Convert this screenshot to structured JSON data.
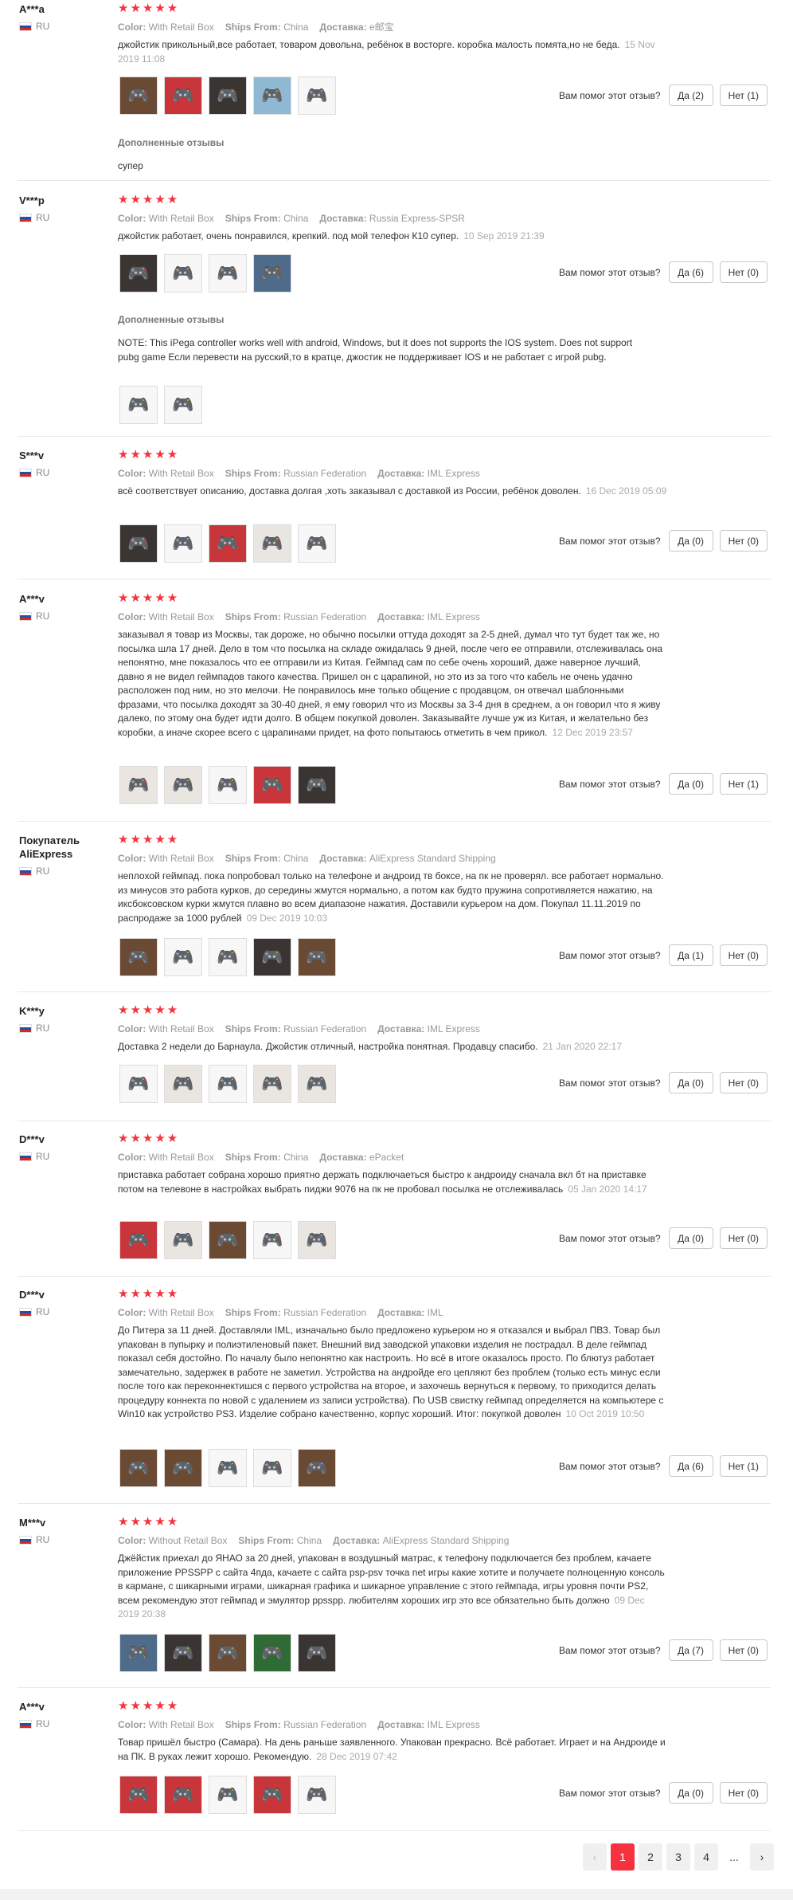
{
  "labels": {
    "color": "Color:",
    "ships_from": "Ships From:",
    "delivery": "Доставка:",
    "helpful_q": "Вам помог этот отзыв?",
    "additional": "Дополненные отзывы"
  },
  "reviews": [
    {
      "user": "A***a",
      "country": "RU",
      "stars": "★★★★★",
      "color": "With Retail Box",
      "ships_from": "China",
      "delivery": "e邮宝",
      "text": "джойстик прикольный,все работает, товаром довольна, ребёнок в восторге. коробка малость помята,но не беда.",
      "date": "15 Nov 2019 11:08",
      "yes": "Да (2)",
      "no": "Нет (1)",
      "photos": [
        {
          "icon": "gamepad-photo"
        },
        {
          "icon": "gamepad-photo"
        },
        {
          "icon": "gamepad-photo"
        },
        {
          "icon": "gamepad-photo"
        },
        {
          "icon": "gamepad-photo"
        }
      ],
      "additional": {
        "text": "супер",
        "photos": []
      }
    },
    {
      "user": "V***p",
      "country": "RU",
      "stars": "★★★★★",
      "color": "With Retail Box",
      "ships_from": "China",
      "delivery": "Russia Express-SPSR",
      "text": "джойстик работает, очень понравился, крепкий. под мой телефон К10 супер.",
      "date": "10 Sep 2019 21:39",
      "yes": "Да (6)",
      "no": "Нет (0)",
      "photos": [
        {
          "icon": "gamepad-photo"
        },
        {
          "icon": "gamepad-photo"
        },
        {
          "icon": "gamepad-photo"
        },
        {
          "icon": "gamepad-photo"
        }
      ],
      "additional": {
        "text": "NOTE: This iPega controller works well with android, Windows, but it does not supports the IOS system. Does not support pubg game Если перевести на русский,то в кратце, джостик не поддерживает IOS и не работает с игрой pubg.",
        "photos": [
          {
            "icon": "gamepad-photo"
          },
          {
            "icon": "gamepad-photo"
          }
        ]
      }
    },
    {
      "user": "S***v",
      "country": "RU",
      "stars": "★★★★★",
      "color": "With Retail Box",
      "ships_from": "Russian Federation",
      "delivery": "IML Express",
      "text": "всё соответствует описанию, доставка долгая ,хоть заказывал с доставкой из России, ребёнок доволен.",
      "date": "16 Dec 2019 05:09",
      "yes": "Да (0)",
      "no": "Нет (0)",
      "photos": [
        {
          "icon": "gamepad-photo"
        },
        {
          "icon": "gamepad-photo"
        },
        {
          "icon": "gamepad-photo"
        },
        {
          "icon": "gamepad-photo"
        },
        {
          "icon": "gamepad-photo"
        }
      ],
      "additional": null
    },
    {
      "user": "A***v",
      "country": "RU",
      "stars": "★★★★★",
      "color": "With Retail Box",
      "ships_from": "Russian Federation",
      "delivery": "IML Express",
      "text": "заказывал я товар из Москвы, так дороже, но обычно посылки оттуда доходят за 2-5 дней, думал что тут будет так же, но посылка шла 17 дней. Дело в том что посылка на складе ожидалась 9 дней, после чего ее отправили, отслеживалась она непонятно, мне показалось что ее отправили из Китая. Геймпад сам по себе очень хороший, даже наверное лучший, давно я не видел геймпадов такого качества. Пришел он с царапиной, но это из за того что кабель не очень удачно расположен под ним, но это мелочи. Не понравилось мне только общение с продавцом, он отвечал шаблонными фразами, что посылка доходят за 30-40 дней, я ему говорил что из Москвы за 3-4 дня в среднем, а он говорил что я живу далеко, по этому она будет идти долго. В общем покупкой доволен. Заказывайте лучше уж из Китая, и желательно без коробки, а иначе скорее всего с царапинами придет, на фото попытаюсь отметить в чем прикол.",
      "date": "12 Dec 2019 23:57",
      "yes": "Да (0)",
      "no": "Нет (1)",
      "photos": [
        {
          "icon": "gamepad-photo"
        },
        {
          "icon": "gamepad-photo"
        },
        {
          "icon": "gamepad-photo"
        },
        {
          "icon": "gamepad-photo"
        },
        {
          "icon": "gamepad-photo"
        }
      ],
      "additional": null
    },
    {
      "user": "Покупатель AliExpress",
      "country": "RU",
      "stars": "★★★★★",
      "color": "With Retail Box",
      "ships_from": "China",
      "delivery": "AliExpress Standard Shipping",
      "text": "неплохой геймпад. пока попробовал только на телефоне и андроид тв боксе, на пк не проверял. все работает нормально. из минусов это работа курков, до середины жмутся нормально, а потом как будто пружина сопротивляется нажатию, на иксбоксовском курки жмутся плавно во всем диапазоне нажатия. Доставили курьером на дом. Покупал 11.11.2019 по распродаже за 1000 рублей",
      "date": "09 Dec 2019 10:03",
      "yes": "Да (1)",
      "no": "Нет (0)",
      "photos": [
        {
          "icon": "gamepad-photo"
        },
        {
          "icon": "gamepad-photo"
        },
        {
          "icon": "gamepad-photo"
        },
        {
          "icon": "gamepad-photo"
        },
        {
          "icon": "gamepad-photo"
        }
      ],
      "additional": null
    },
    {
      "user": "K***y",
      "country": "RU",
      "stars": "★★★★★",
      "color": "With Retail Box",
      "ships_from": "Russian Federation",
      "delivery": "IML Express",
      "text": "Доставка 2 недели до Барнаула. Джойстик отличный, настройка понятная. Продавцу спасибо.",
      "date": "21 Jan 2020 22:17",
      "yes": "Да (0)",
      "no": "Нет (0)",
      "photos": [
        {
          "icon": "gamepad-photo"
        },
        {
          "icon": "gamepad-photo"
        },
        {
          "icon": "gamepad-photo"
        },
        {
          "icon": "gamepad-photo"
        },
        {
          "icon": "gamepad-photo"
        }
      ],
      "additional": null
    },
    {
      "user": "D***v",
      "country": "RU",
      "stars": "★★★★★",
      "color": "With Retail Box",
      "ships_from": "China",
      "delivery": "ePacket",
      "text": "приставка работает собрана хорошо приятно держать подключаеться быстро к андроиду сначала вкл бт на приставке потом на телевоне в настройках выбрать пиджи 9076 на пк не пробовал посылка не отслеживалась",
      "date": "05 Jan 2020 14:17",
      "yes": "Да (0)",
      "no": "Нет (0)",
      "photos": [
        {
          "icon": "gamepad-photo"
        },
        {
          "icon": "gamepad-photo"
        },
        {
          "icon": "gamepad-photo"
        },
        {
          "icon": "gamepad-photo"
        },
        {
          "icon": "gamepad-photo"
        }
      ],
      "additional": null
    },
    {
      "user": "D***v",
      "country": "RU",
      "stars": "★★★★★",
      "color": "With Retail Box",
      "ships_from": "Russian Federation",
      "delivery": "IML",
      "text": "До Питера за 11 дней. Доставляли IML, изначально было предложено курьером но я отказался и выбрал ПВЗ. Товар был упакован в пупырку и полиэтиленовый пакет. Внешний вид заводской упаковки изделия не пострадал. В деле геймпад показал себя достойно. По началу было непонятно как настроить. Но всё в итоге оказалось просто. По блютуз работает замечательно, задержек в работе не заметил. Устройства на андройде его цепляют без проблем (только есть минус если после того как переконнектишся с первого устройства на второе, и захочешь вернуться к первому, то приходится делать процедуру коннекта по новой с удалением из записи устройства). По USB свистку геймпад определяется на компьютере с Win10 как устройство PS3. Изделие собрано качественно, корпус хороший. Итог: покупкой доволен",
      "date": "10 Oct 2019 10:50",
      "yes": "Да (6)",
      "no": "Нет (1)",
      "photos": [
        {
          "icon": "gamepad-photo"
        },
        {
          "icon": "gamepad-photo"
        },
        {
          "icon": "gamepad-photo"
        },
        {
          "icon": "gamepad-photo"
        },
        {
          "icon": "gamepad-photo"
        }
      ],
      "additional": null
    },
    {
      "user": "M***v",
      "country": "RU",
      "stars": "★★★★★",
      "color": "Without Retail Box",
      "ships_from": "China",
      "delivery": "AliExpress Standard Shipping",
      "text": "Джёйстик приехал до ЯНАО за 20 дней, упакован в воздушный матрас, к телефону подключается без проблем, качаете приложение PPSSPP с сайта 4пда, качаете с сайта psp-psv точка net игры какие хотите и получаете полноценную консоль в кармане, с шикарными играми, шикарная графика и шикарное управление с этого геймпада, игры уровня почти PS2, всем рекомендую этот геймпад и эмулятор ppsspp. любителям хороших игр это все обязательно быть должно",
      "date": "09 Dec 2019 20:38",
      "yes": "Да (7)",
      "no": "Нет (0)",
      "photos": [
        {
          "icon": "gamepad-photo"
        },
        {
          "icon": "gamepad-photo"
        },
        {
          "icon": "gamepad-photo"
        },
        {
          "icon": "gamepad-photo"
        },
        {
          "icon": "gamepad-photo"
        }
      ],
      "additional": null
    },
    {
      "user": "A***v",
      "country": "RU",
      "stars": "★★★★★",
      "color": "With Retail Box",
      "ships_from": "Russian Federation",
      "delivery": "IML Express",
      "text": "Товар пришёл быстро (Самара). На день раньше заявленного. Упакован прекрасно. Всё работает. Играет и на Андроиде и на ПК. В руках лежит хорошо. Рекомендую.",
      "date": "28 Dec 2019 07:42",
      "yes": "Да (0)",
      "no": "Нет (0)",
      "photos": [
        {
          "icon": "gamepad-photo"
        },
        {
          "icon": "gamepad-photo"
        },
        {
          "icon": "gamepad-photo"
        },
        {
          "icon": "gamepad-photo"
        },
        {
          "icon": "gamepad-photo"
        }
      ],
      "additional": null
    }
  ],
  "pagination": {
    "prev": "‹",
    "pages": [
      "1",
      "2",
      "3",
      "4"
    ],
    "active": "1",
    "ellipsis": "...",
    "next": "›"
  }
}
